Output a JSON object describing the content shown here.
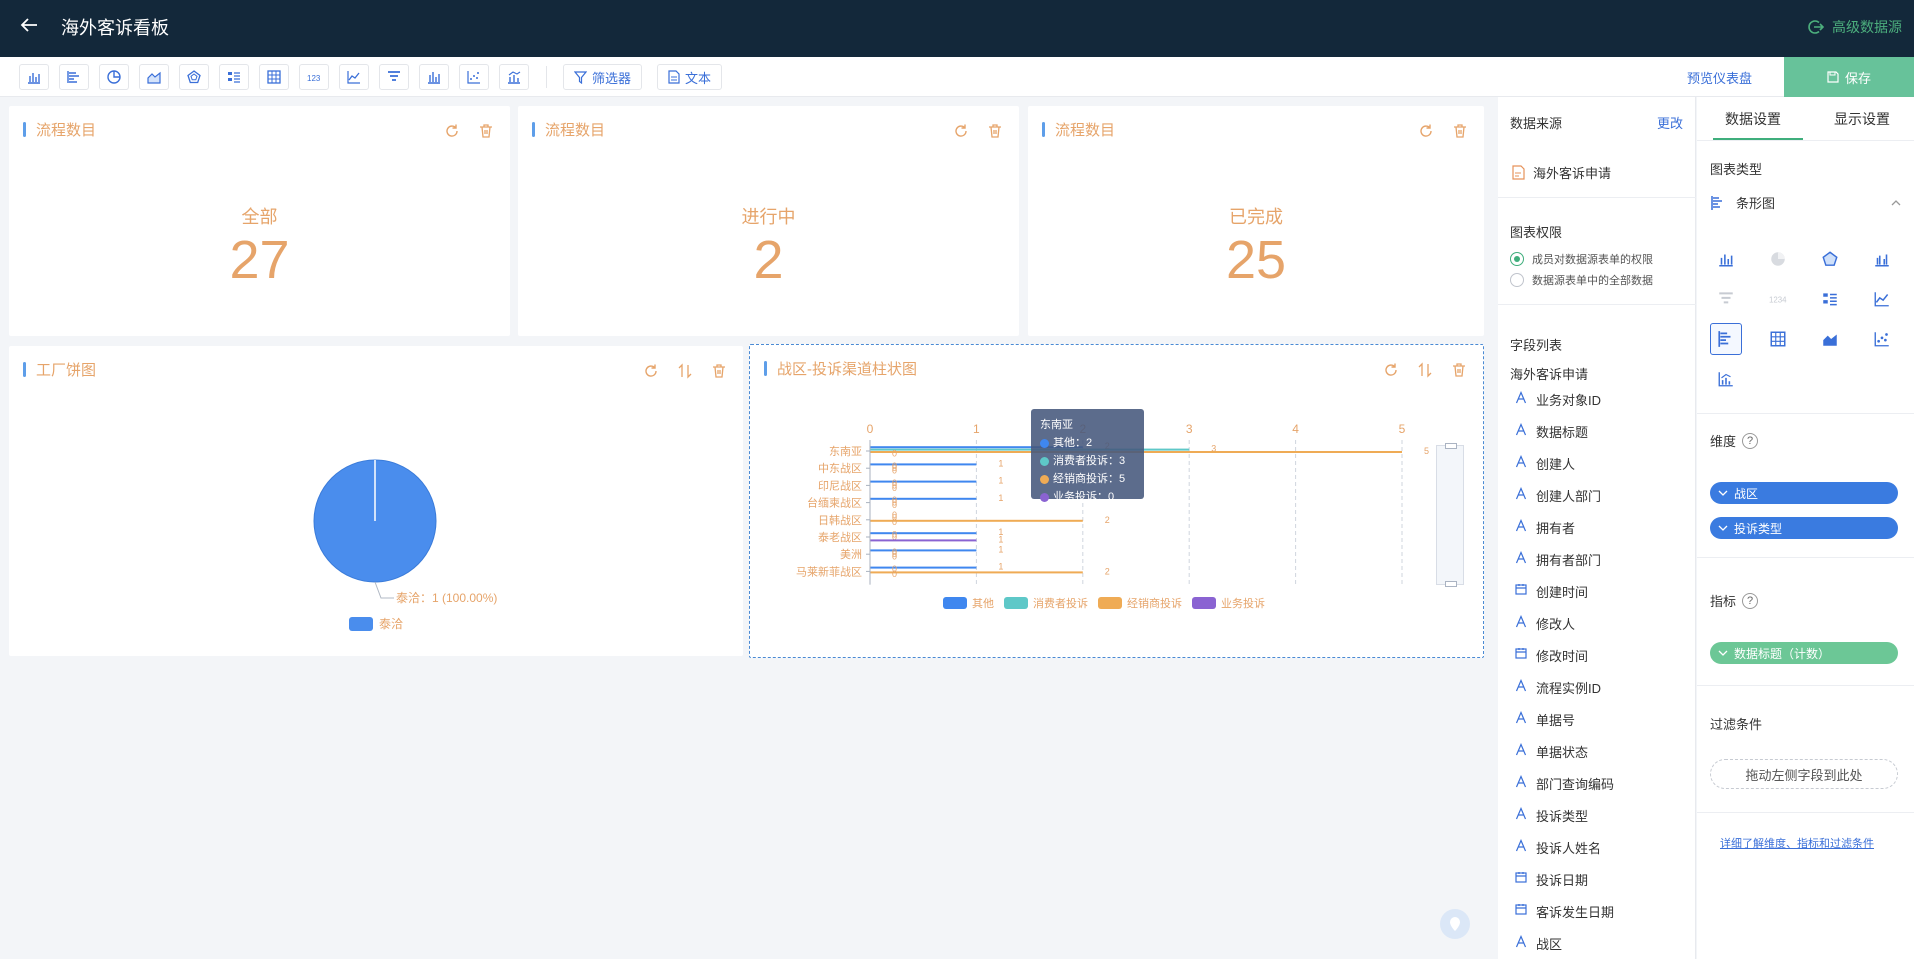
{
  "app": {
    "title": "海外客诉看板",
    "datasource_link": "高级数据源",
    "preview": "预览仪表盘",
    "save": "保存"
  },
  "toolbar": {
    "filter": "筛选器",
    "text": "文本"
  },
  "cards": [
    {
      "title": "流程数目",
      "label": "全部",
      "value": "27"
    },
    {
      "title": "流程数目",
      "label": "进行中",
      "value": "2"
    },
    {
      "title": "流程数目",
      "label": "已完成",
      "value": "25"
    }
  ],
  "pie_card": {
    "title": "工厂饼图",
    "slice_label": "泰洽：1 (100.00%)",
    "legend": "泰洽"
  },
  "bar_card": {
    "title": "战区-投诉渠道柱状图"
  },
  "chart_data": {
    "type": "bar",
    "orientation": "horizontal",
    "categories": [
      "东南亚",
      "中东战区",
      "印尼战区",
      "台缅柬战区",
      "日韩战区",
      "泰老战区",
      "美洲",
      "马莱新菲战区"
    ],
    "series": [
      {
        "name": "其他",
        "color": "#3f87ef",
        "values": [
          2,
          1,
          1,
          1,
          0,
          1,
          1,
          1
        ]
      },
      {
        "name": "消费者投诉",
        "color": "#5ec8c8",
        "values": [
          3,
          0,
          0,
          0,
          0,
          0,
          0,
          0
        ]
      },
      {
        "name": "经销商投诉",
        "color": "#efab55",
        "values": [
          5,
          0,
          0,
          0,
          2,
          0,
          0,
          2
        ]
      },
      {
        "name": "业务投诉",
        "color": "#8a63d2",
        "values": [
          0,
          0,
          0,
          0,
          0,
          1,
          0,
          0
        ]
      }
    ],
    "xlim": [
      0,
      5
    ],
    "xticks": [
      "0",
      "1",
      "2",
      "3",
      "4",
      "5"
    ],
    "tooltip": {
      "title": "东南亚",
      "rows": [
        "其他：2",
        "消费者投诉：3",
        "经销商投诉：5",
        "业务投诉：0"
      ]
    }
  },
  "fields": {
    "source_title": "数据来源",
    "change": "更改",
    "source": "海外客诉申请",
    "perm_title": "图表权限",
    "perm_options": [
      "成员对数据源表单的权限",
      "数据源表单中的全部数据"
    ],
    "list_title": "字段列表",
    "group": "海外客诉申请",
    "items": [
      {
        "type": "A",
        "label": "业务对象ID"
      },
      {
        "type": "A",
        "label": "数据标题"
      },
      {
        "type": "A",
        "label": "创建人"
      },
      {
        "type": "A",
        "label": "创建人部门"
      },
      {
        "type": "A",
        "label": "拥有者"
      },
      {
        "type": "A",
        "label": "拥有者部门"
      },
      {
        "type": "date",
        "label": "创建时间"
      },
      {
        "type": "A",
        "label": "修改人"
      },
      {
        "type": "date",
        "label": "修改时间"
      },
      {
        "type": "A",
        "label": "流程实例ID"
      },
      {
        "type": "A",
        "label": "单据号"
      },
      {
        "type": "A",
        "label": "单据状态"
      },
      {
        "type": "A",
        "label": "部门查询编码"
      },
      {
        "type": "A",
        "label": "投诉类型"
      },
      {
        "type": "A",
        "label": "投诉人姓名"
      },
      {
        "type": "date",
        "label": "投诉日期"
      },
      {
        "type": "date",
        "label": "客诉发生日期"
      },
      {
        "type": "A",
        "label": "战区"
      }
    ]
  },
  "settings": {
    "tabs": [
      "数据设置",
      "显示设置"
    ],
    "chart_type_title": "图表类型",
    "chart_type": "条形图",
    "dimension_title": "维度",
    "dimensions": [
      "战区",
      "投诉类型"
    ],
    "metric_title": "指标",
    "metrics": [
      "数据标题（计数）"
    ],
    "filter_title": "过滤条件",
    "filter_placeholder": "拖动左侧字段到此处",
    "help_link": "详细了解维度、指标和过滤条件"
  },
  "colors": {
    "accent": "#3a6fd8",
    "title": "#e6a46a",
    "save": "#67c29a",
    "topbar": "#13283a"
  }
}
